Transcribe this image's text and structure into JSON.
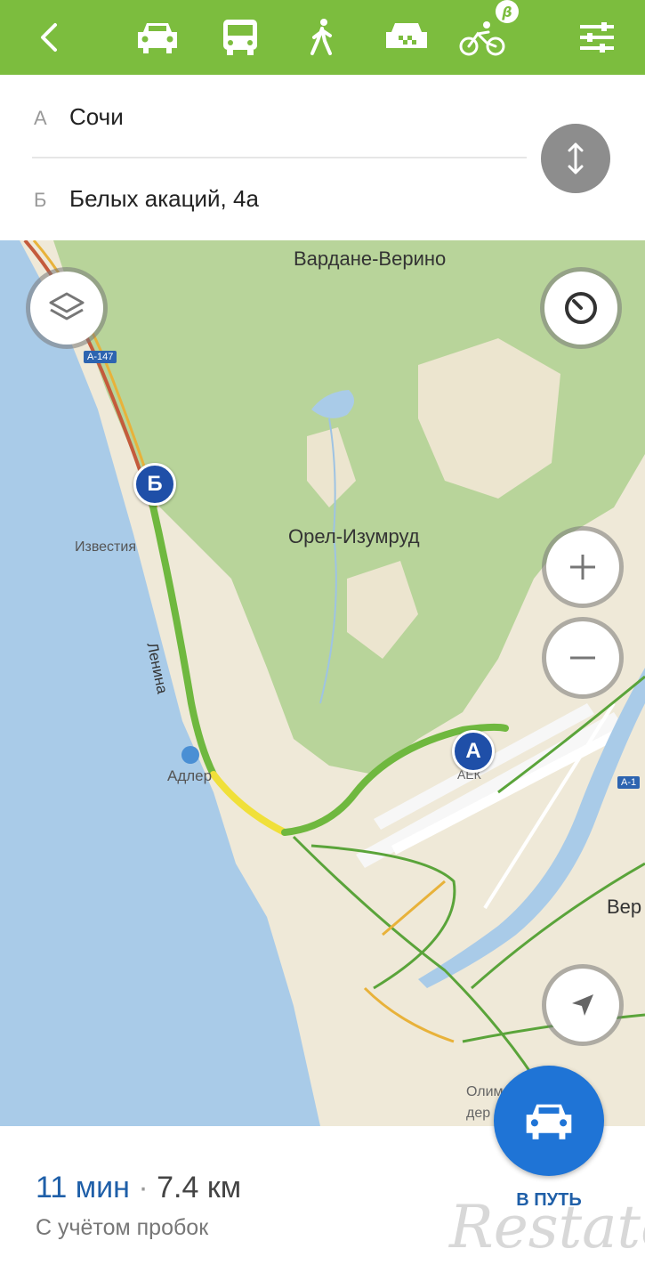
{
  "colors": {
    "topbar": "#7cbd3e",
    "accent_blue": "#1f4fa8",
    "route_green": "#6fb83f",
    "water": "#a9cbe8",
    "forest": "#b8d49a"
  },
  "topbar": {
    "icons": [
      "back-arrow-icon",
      "car-icon",
      "bus-icon",
      "walk-icon",
      "taxi-icon",
      "bike-icon",
      "settings-sliders-icon"
    ],
    "beta_badge": "β"
  },
  "route": {
    "from_letter": "А",
    "from_value": "Сочи",
    "to_letter": "Б",
    "to_value": "Белых акаций, 4а"
  },
  "map": {
    "labels": {
      "vardane": "Вардане-Верино",
      "orel": "Орел-Изумруд",
      "izvestia": "Известия",
      "lenina": "Ленина",
      "adler": "Адлер",
      "aer": "АЕК",
      "ver": "Вер",
      "olim": "Олим",
      "der": "дер"
    },
    "road_shields": [
      "А-147",
      "А-1"
    ],
    "marker_a": "А",
    "marker_b": "Б"
  },
  "summary": {
    "time": "11 мин",
    "separator": " · ",
    "distance": "7.4 км",
    "note": "С учётом пробок"
  },
  "go_button": {
    "label": "В ПУТЬ"
  },
  "watermark": "Restate"
}
